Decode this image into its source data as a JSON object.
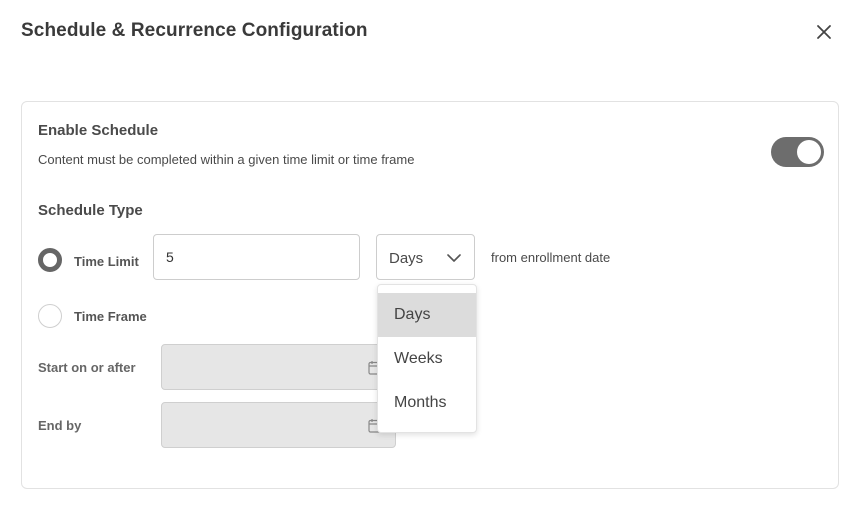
{
  "dialog": {
    "title": "Schedule & Recurrence Configuration"
  },
  "enable_schedule": {
    "heading": "Enable Schedule",
    "description": "Content must be completed within a given time limit or time frame",
    "toggle_on": true
  },
  "schedule_type": {
    "heading": "Schedule Type",
    "time_limit": {
      "label": "Time Limit",
      "selected": true,
      "value": "5",
      "unit": "Days",
      "suffix": "from enrollment date"
    },
    "time_frame": {
      "label": "Time Frame",
      "selected": false,
      "start_label": "Start on or after",
      "end_label": "End by"
    }
  },
  "unit_dropdown": {
    "options": [
      "Days",
      "Weeks",
      "Months"
    ],
    "selected": "Days"
  },
  "icons": {
    "close": "close-icon",
    "chevron": "chevron-down-icon",
    "calendar": "calendar-icon"
  },
  "colors": {
    "toggle_on": "#6d6d6d",
    "disabled_field": "#e6e6e6",
    "option_highlight": "#dcdcdc"
  }
}
